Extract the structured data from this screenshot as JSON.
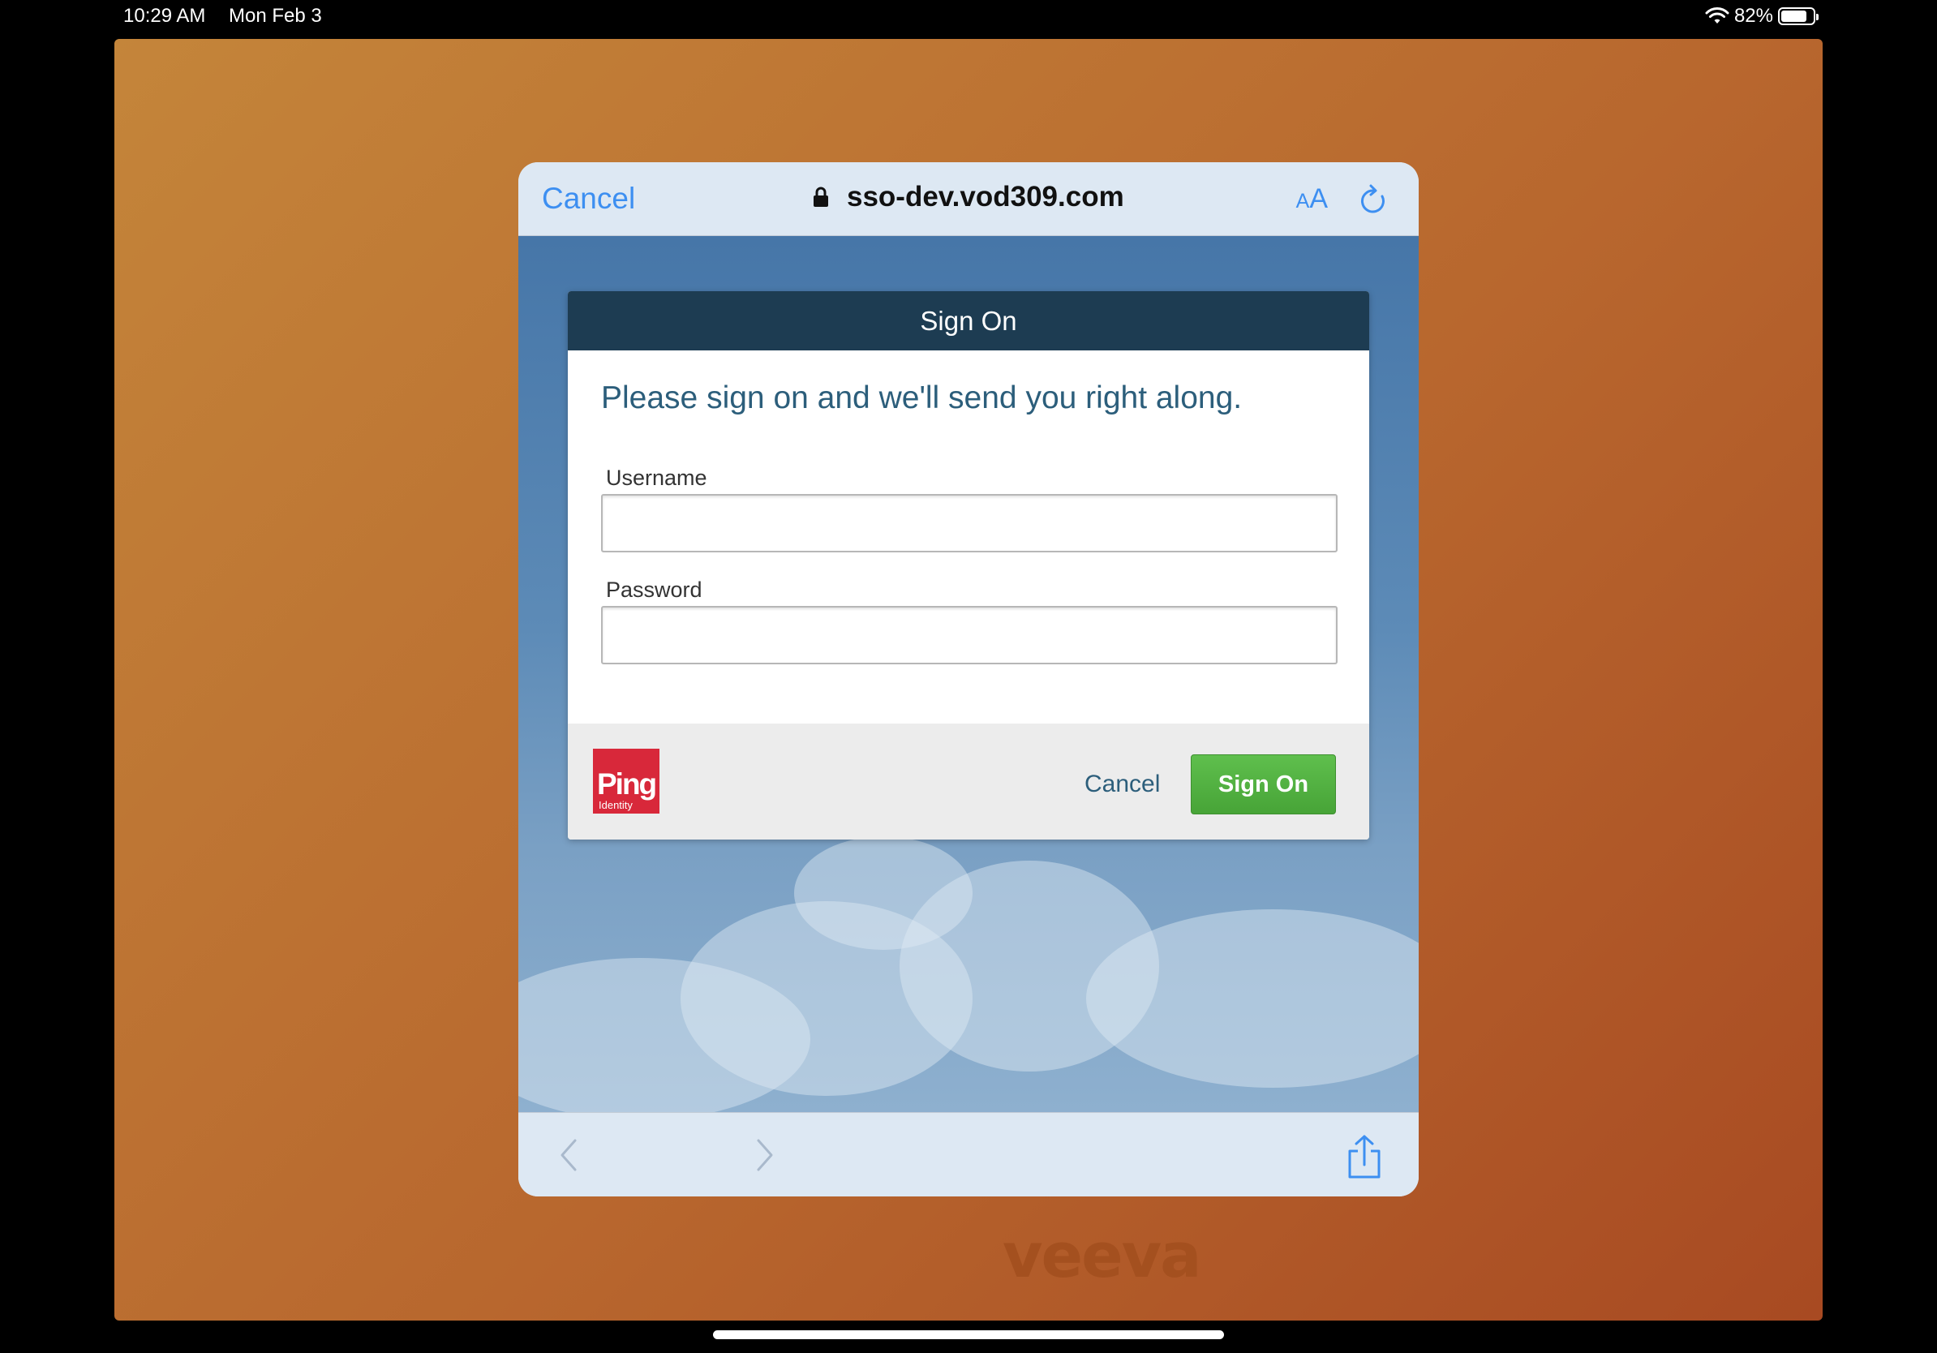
{
  "status_bar": {
    "time": "10:29 AM",
    "date": "Mon Feb 3",
    "battery_text": "82%",
    "battery_level": 0.82,
    "icons": [
      "wifi-icon",
      "battery-icon"
    ]
  },
  "background_app": {
    "logo_text": "veeva"
  },
  "browser": {
    "cancel_label": "Cancel",
    "url": "sso-dev.vod309.com",
    "text_size_label_small": "A",
    "text_size_label_large": "A",
    "icons": [
      "lock-icon",
      "text-size-icon",
      "reload-icon",
      "back-icon",
      "forward-icon",
      "share-icon"
    ]
  },
  "signin": {
    "header_title": "Sign On",
    "subtitle": "Please sign on and we'll send you right along.",
    "username_label": "Username",
    "username_value": "",
    "password_label": "Password",
    "password_value": "",
    "cancel_label": "Cancel",
    "submit_label": "Sign On",
    "logo_word": "Ping",
    "logo_sub": "Identity",
    "colors": {
      "header": "#1d3c52",
      "submit": "#47a437",
      "logo": "#d8283a",
      "link": "#2c5e7b"
    }
  },
  "colors": {
    "ios_blue": "#3d8ff1",
    "app_bg": "#b8672e"
  }
}
